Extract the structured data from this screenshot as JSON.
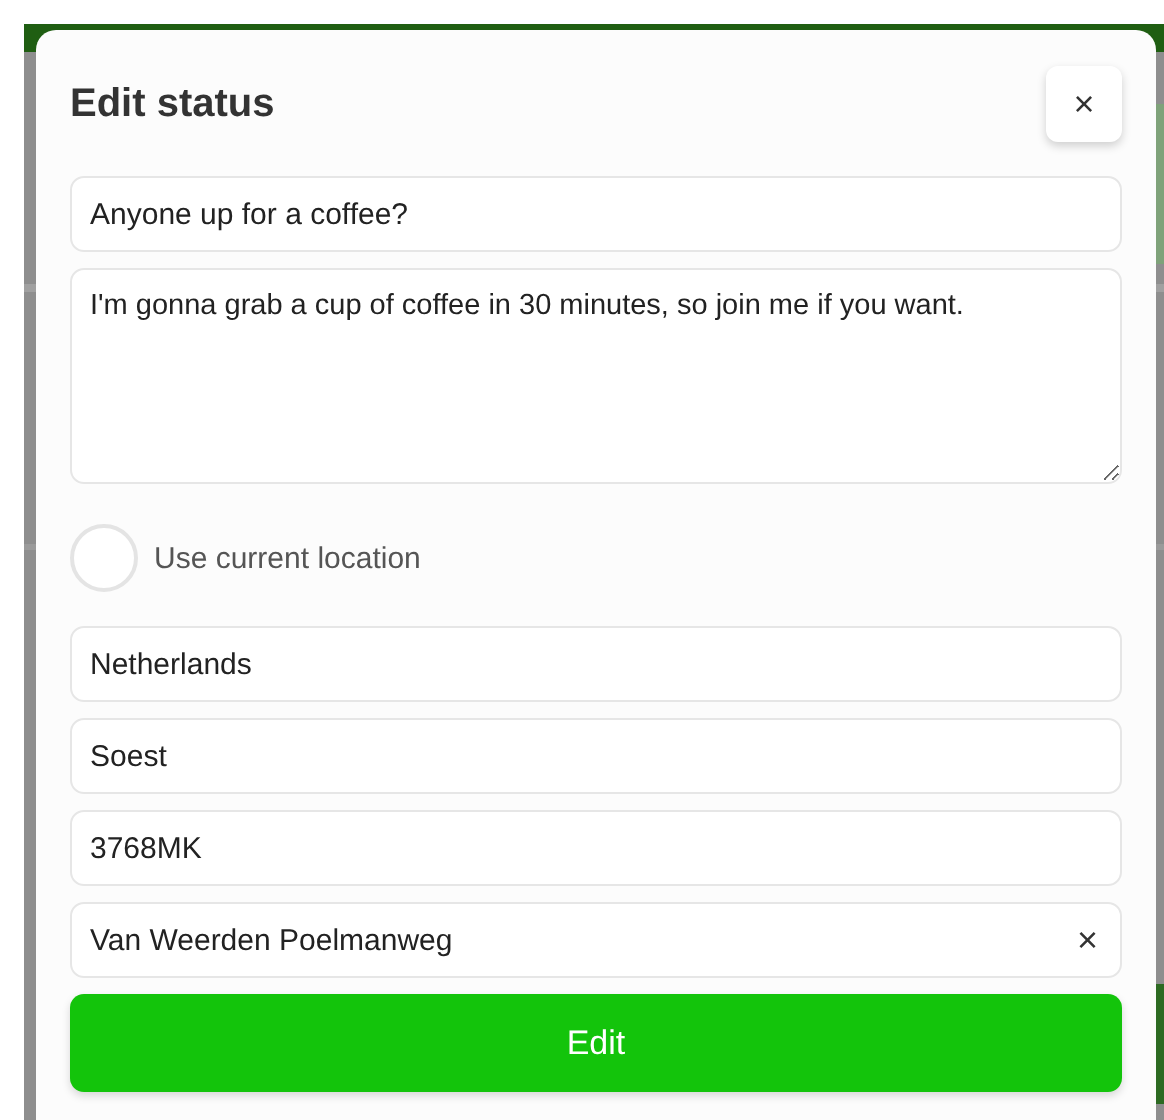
{
  "dialog": {
    "title": "Edit status",
    "close": "×"
  },
  "status": {
    "title": "Anyone up for a coffee?",
    "message": "I'm gonna grab a cup of coffee in 30 minutes, so join me if you want."
  },
  "location_toggle": {
    "label": "Use current location",
    "checked": false
  },
  "address_fields": [
    {
      "value": "Netherlands"
    },
    {
      "value": "Soest"
    },
    {
      "value": "3768MK"
    },
    {
      "value": "Van Weerden Poelmanweg",
      "clear": "×"
    }
  ],
  "submit": "Edit"
}
